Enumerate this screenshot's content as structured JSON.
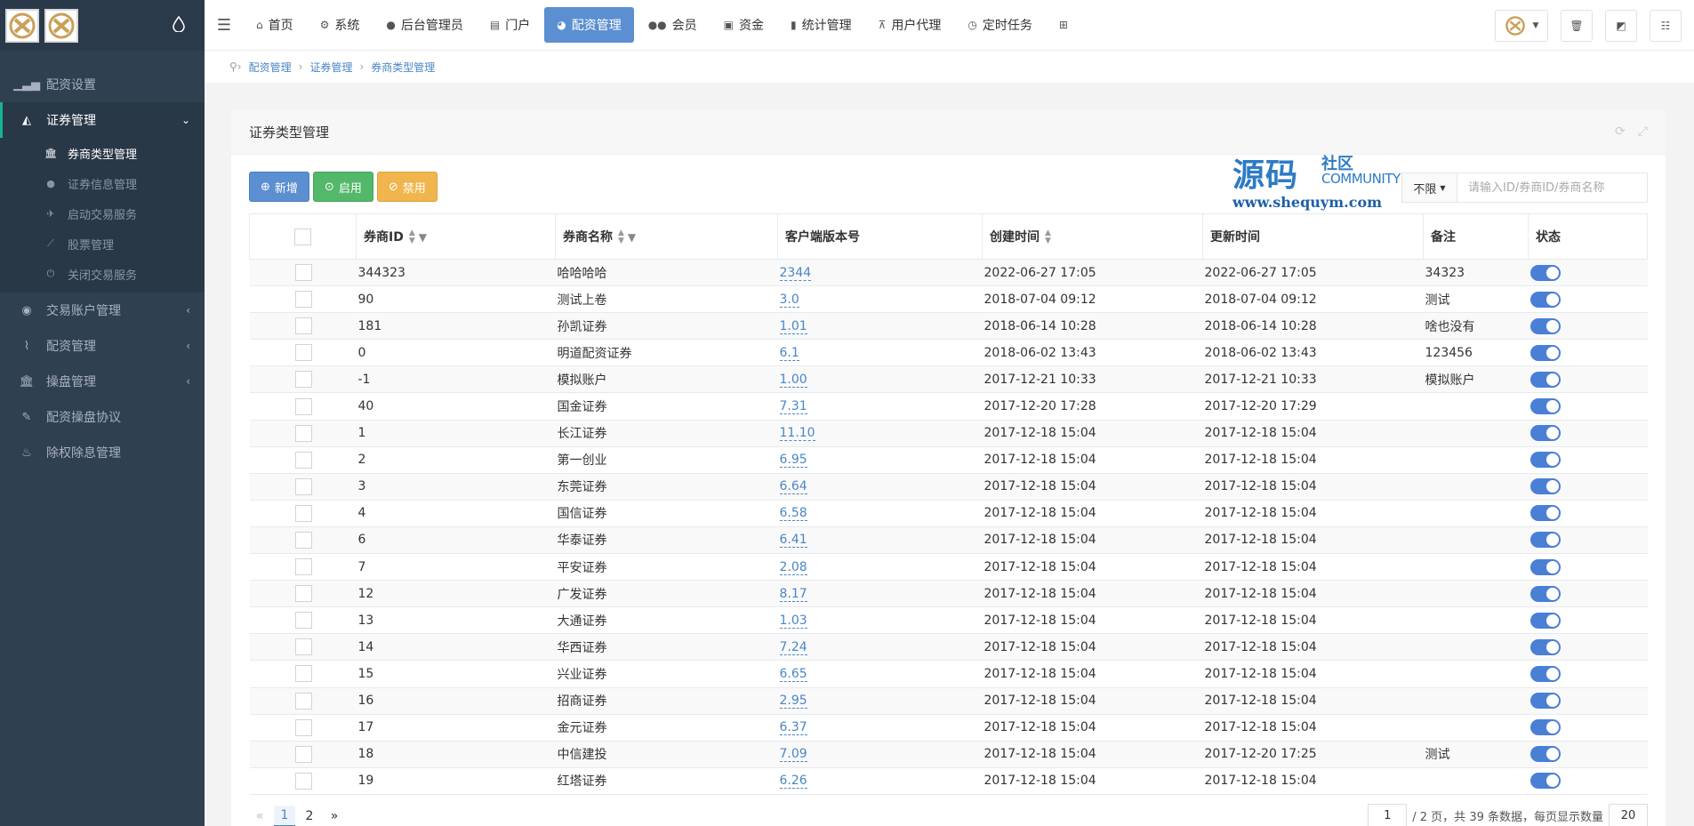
{
  "sidebar": {
    "items": [
      {
        "label": "配资设置",
        "icon": "signal-icon"
      },
      {
        "label": "证券管理",
        "icon": "area-chart-icon"
      },
      {
        "label": "交易账户管理",
        "icon": "user-circle-icon"
      },
      {
        "label": "配资管理",
        "icon": "paperclip-icon"
      },
      {
        "label": "操盘管理",
        "icon": "bank-icon"
      },
      {
        "label": "配资操盘协议",
        "icon": "pencil-icon"
      },
      {
        "label": "除权除息管理",
        "icon": "fire-icon"
      }
    ],
    "sub_items": [
      {
        "label": "券商类型管理",
        "icon": "bank-icon"
      },
      {
        "label": "证券信息管理",
        "icon": "user-icon"
      },
      {
        "label": "启动交易服务",
        "icon": "rocket-icon"
      },
      {
        "label": "股票管理",
        "icon": "line-chart-icon"
      },
      {
        "label": "关闭交易服务",
        "icon": "power-icon"
      }
    ]
  },
  "topbar": {
    "tabs": [
      {
        "label": "首页",
        "icon": "home-icon"
      },
      {
        "label": "系统",
        "icon": "gear-icon"
      },
      {
        "label": "后台管理员",
        "icon": "user-icon"
      },
      {
        "label": "门户",
        "icon": "newspaper-icon"
      },
      {
        "label": "配资管理",
        "icon": "pie-chart-icon"
      },
      {
        "label": "会员",
        "icon": "users-icon"
      },
      {
        "label": "资金",
        "icon": "money-icon"
      },
      {
        "label": "统计管理",
        "icon": "bar-chart-icon"
      },
      {
        "label": "用户代理",
        "icon": "sitemap-icon"
      },
      {
        "label": "定时任务",
        "icon": "clock-icon"
      }
    ]
  },
  "breadcrumb": [
    "配资管理",
    "证券管理",
    "券商类型管理"
  ],
  "panel": {
    "title": "证券类型管理",
    "buttons": {
      "add": "新增",
      "enable": "启用",
      "disable": "禁用"
    },
    "search": {
      "select_value": "不限",
      "placeholder": "请输入ID/券商ID/券商名称"
    },
    "watermark": {
      "big": "源码",
      "small": "社区",
      "community": "COMMUNITY",
      "url": "www.shequym.com"
    }
  },
  "table": {
    "headers": [
      "券商ID",
      "券商名称",
      "客户端版本号",
      "创建时间",
      "更新时间",
      "备注",
      "状态"
    ],
    "rows": [
      {
        "id": "344323",
        "name": "哈哈哈哈",
        "version": "2344",
        "created": "2022-06-27 17:05",
        "updated": "2022-06-27 17:05",
        "note": "34323"
      },
      {
        "id": "90",
        "name": "测试上卷",
        "version": "3.0",
        "created": "2018-07-04 09:12",
        "updated": "2018-07-04 09:12",
        "note": "测试"
      },
      {
        "id": "181",
        "name": "孙凯证券",
        "version": "1.01",
        "created": "2018-06-14 10:28",
        "updated": "2018-06-14 10:28",
        "note": "啥也没有"
      },
      {
        "id": "0",
        "name": "明道配资证券",
        "version": "6.1",
        "created": "2018-06-02 13:43",
        "updated": "2018-06-02 13:43",
        "note": "123456"
      },
      {
        "id": "-1",
        "name": "模拟账户",
        "version": "1.00",
        "created": "2017-12-21 10:33",
        "updated": "2017-12-21 10:33",
        "note": "模拟账户"
      },
      {
        "id": "40",
        "name": "国金证券",
        "version": "7.31",
        "created": "2017-12-20 17:28",
        "updated": "2017-12-20 17:29",
        "note": ""
      },
      {
        "id": "1",
        "name": "长江证券",
        "version": "11.10",
        "created": "2017-12-18 15:04",
        "updated": "2017-12-18 15:04",
        "note": ""
      },
      {
        "id": "2",
        "name": "第一创业",
        "version": "6.95",
        "created": "2017-12-18 15:04",
        "updated": "2017-12-18 15:04",
        "note": ""
      },
      {
        "id": "3",
        "name": "东莞证券",
        "version": "6.64",
        "created": "2017-12-18 15:04",
        "updated": "2017-12-18 15:04",
        "note": ""
      },
      {
        "id": "4",
        "name": "国信证券",
        "version": "6.58",
        "created": "2017-12-18 15:04",
        "updated": "2017-12-18 15:04",
        "note": ""
      },
      {
        "id": "6",
        "name": "华泰证券",
        "version": "6.41",
        "created": "2017-12-18 15:04",
        "updated": "2017-12-18 15:04",
        "note": ""
      },
      {
        "id": "7",
        "name": "平安证券",
        "version": "2.08",
        "created": "2017-12-18 15:04",
        "updated": "2017-12-18 15:04",
        "note": ""
      },
      {
        "id": "12",
        "name": "广发证券",
        "version": "8.17",
        "created": "2017-12-18 15:04",
        "updated": "2017-12-18 15:04",
        "note": ""
      },
      {
        "id": "13",
        "name": "大通证券",
        "version": "1.03",
        "created": "2017-12-18 15:04",
        "updated": "2017-12-18 15:04",
        "note": ""
      },
      {
        "id": "14",
        "name": "华西证券",
        "version": "7.24",
        "created": "2017-12-18 15:04",
        "updated": "2017-12-18 15:04",
        "note": ""
      },
      {
        "id": "15",
        "name": "兴业证券",
        "version": "6.65",
        "created": "2017-12-18 15:04",
        "updated": "2017-12-18 15:04",
        "note": ""
      },
      {
        "id": "16",
        "name": "招商证券",
        "version": "2.95",
        "created": "2017-12-18 15:04",
        "updated": "2017-12-18 15:04",
        "note": ""
      },
      {
        "id": "17",
        "name": "金元证券",
        "version": "6.37",
        "created": "2017-12-18 15:04",
        "updated": "2017-12-18 15:04",
        "note": ""
      },
      {
        "id": "18",
        "name": "中信建投",
        "version": "7.09",
        "created": "2017-12-18 15:04",
        "updated": "2017-12-20 17:25",
        "note": "测试"
      },
      {
        "id": "19",
        "name": "红塔证券",
        "version": "6.26",
        "created": "2017-12-18 15:04",
        "updated": "2017-12-18 15:04",
        "note": ""
      }
    ]
  },
  "pagination": {
    "prev": "«",
    "pages": [
      "1",
      "2"
    ],
    "next": "»",
    "current_input": "1",
    "total_pages_text": "/ 2 页，共 39 条数据，每页显示数量",
    "page_size": "20"
  },
  "colors": {
    "sidebar_bg": "#2f4050",
    "accent": "#5b8fd1",
    "enable": "#54b86a",
    "disable": "#f0b54c",
    "toggle_on": "#4a7fd6"
  }
}
